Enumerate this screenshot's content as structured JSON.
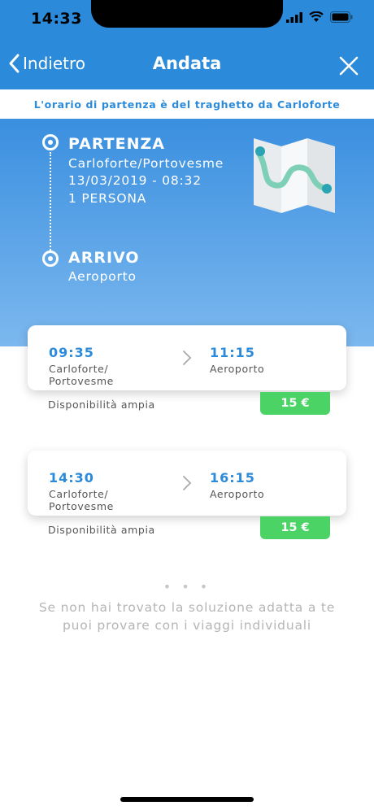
{
  "status_bar": {
    "time": "14:33"
  },
  "nav": {
    "back_label": "Indietro",
    "title": "Andata"
  },
  "banner": {
    "text": "L'orario di partenza è del traghetto da Carloforte"
  },
  "route": {
    "departure_label": "PARTENZA",
    "departure_place": "Carloforte/Portovesme",
    "departure_datetime": "13/03/2019 - 08:32",
    "passengers": "1 PERSONA",
    "arrival_label": "ARRIVO",
    "arrival_place": "Aeroporto"
  },
  "results": [
    {
      "dep_time": "09:35",
      "dep_place_1": "Carloforte/",
      "dep_place_2": "Portovesme",
      "arr_time": "11:15",
      "arr_place": "Aeroporto",
      "availability": "Disponibilità ampia",
      "price": "15 €"
    },
    {
      "dep_time": "14:30",
      "dep_place_1": "Carloforte/",
      "dep_place_2": "Portovesme",
      "arr_time": "16:15",
      "arr_place": "Aeroporto",
      "availability": "Disponibilità ampia",
      "price": "15 €"
    }
  ],
  "footer": {
    "dots": "• • •",
    "line1": "Se non hai trovato la soluzione adatta a te",
    "line2": "puoi provare con i viaggi individuali"
  },
  "colors": {
    "primary": "#2b8ad9",
    "price_green": "#4cd366"
  },
  "icons": [
    "signal-icon",
    "wifi-icon",
    "battery-icon",
    "back-chevron-icon",
    "close-icon",
    "map-icon",
    "chevron-right-icon"
  ]
}
